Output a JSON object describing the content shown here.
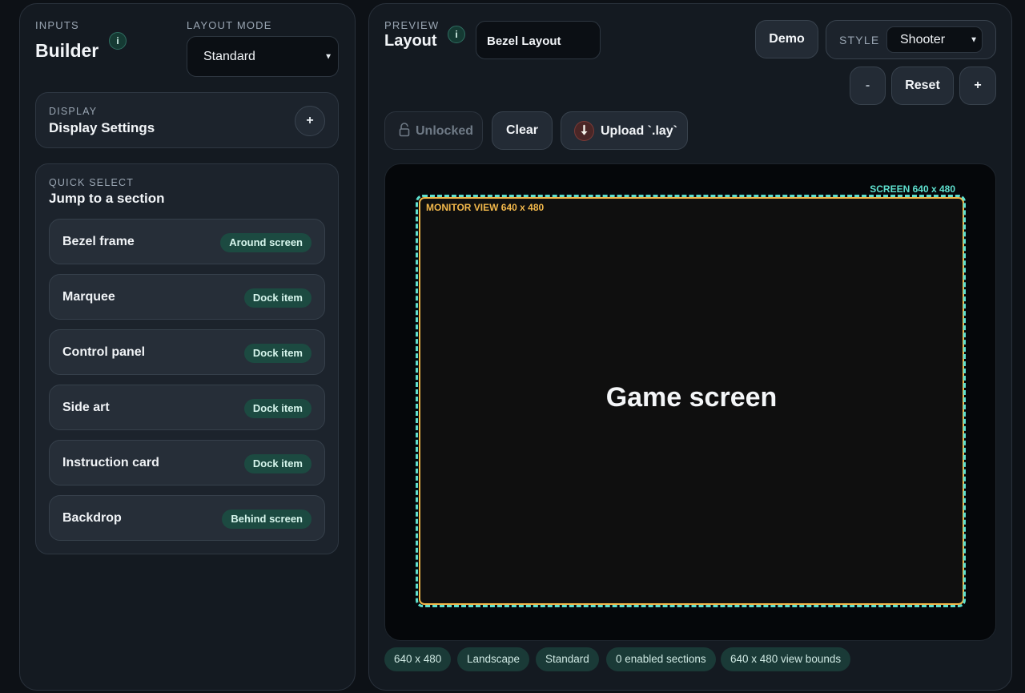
{
  "builder": {
    "eyebrow": "INPUTS",
    "title": "Builder",
    "info": "i",
    "layout_mode_label": "LAYOUT MODE",
    "layout_mode_value": "Standard"
  },
  "display": {
    "eyebrow": "DISPLAY",
    "title": "Display Settings",
    "add_label": "+"
  },
  "quick_select": {
    "eyebrow": "QUICK SELECT",
    "title": "Jump to a section",
    "items": [
      {
        "label": "Bezel frame",
        "tag": "Around screen"
      },
      {
        "label": "Marquee",
        "tag": "Dock item"
      },
      {
        "label": "Control panel",
        "tag": "Dock item"
      },
      {
        "label": "Side art",
        "tag": "Dock item"
      },
      {
        "label": "Instruction card",
        "tag": "Dock item"
      },
      {
        "label": "Backdrop",
        "tag": "Behind screen"
      }
    ]
  },
  "preview": {
    "eyebrow": "PREVIEW",
    "title": "Layout",
    "info": "i",
    "name_value": "Bezel Layout",
    "demo_label": "Demo",
    "style_label": "STYLE",
    "style_value": "Shooter",
    "zoom_out_label": "-",
    "reset_label": "Reset",
    "zoom_in_label": "+",
    "lock_label": "Unlocked",
    "clear_label": "Clear",
    "upload_label": "Upload `.lay`"
  },
  "canvas": {
    "screen_label": "SCREEN 640 x 480",
    "monitor_label": "MONITOR VIEW 640 x 480",
    "game_label": "Game screen"
  },
  "status_chips": [
    "640 x 480",
    "Landscape",
    "Standard",
    "0 enabled sections",
    "640 x 480 view bounds"
  ],
  "colors": {
    "accent_teal": "#5ee0cf",
    "accent_gold": "#f2b84b",
    "tag_bg": "#1c4a41"
  }
}
